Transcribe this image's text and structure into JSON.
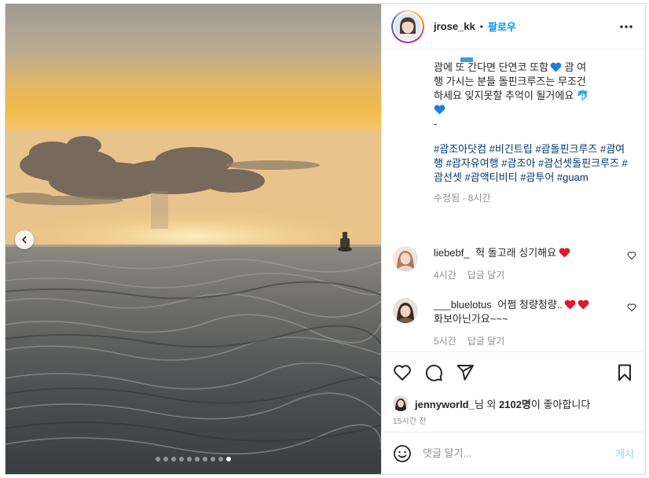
{
  "post": {
    "username": "jrose_kk",
    "separator": "•",
    "follow_label": "팔로우",
    "more_icon": "more-horizontal-icon",
    "slide_count": 10,
    "active_slide": 10
  },
  "caption": {
    "line_1": "괌에 또 간다면 단연코 또함",
    "line_1_end": " 괌 여",
    "line_2": "행 가시는 분들 돌핀크루즈는 무조건",
    "line_3": "하세요 잊지못할 추억이 될거에요 🐬",
    "line_4": "💙",
    "line_5": "-",
    "hashtags": [
      "#괌조아닷컴",
      "#비긴트립",
      "#괌돌핀크루즈",
      "#괌여행",
      "#괌자유여행",
      "#괌조아",
      "#괌선셋돌핀크루즈",
      "#괌선셋",
      "#괌액티비티",
      "#괌투어",
      "#guam"
    ],
    "meta": "수정됨 · 8시간"
  },
  "comments": [
    {
      "username": "liebebf_",
      "text": "헉 돌고래 싱기해요",
      "time": "4시간",
      "reply_label": "답글 달기"
    },
    {
      "username": "___bluelotus",
      "text": "어쩜 청량청량..",
      "text_2": "화보아닌가요~~~",
      "time": "5시간",
      "reply_label": "답글 달기"
    }
  ],
  "likes": {
    "liker": "jennyworld_",
    "suffix_1": "님 외 ",
    "count": "2102명",
    "suffix_2": "이 좋아합니다"
  },
  "timestamp": "15시간 전",
  "composer": {
    "placeholder": "댓글 달기...",
    "post_label": "게시"
  },
  "colors": {
    "accent": "#0095f6",
    "hashtag": "#00376b",
    "heart": "#ed4956",
    "muted": "#8e8e8e"
  }
}
